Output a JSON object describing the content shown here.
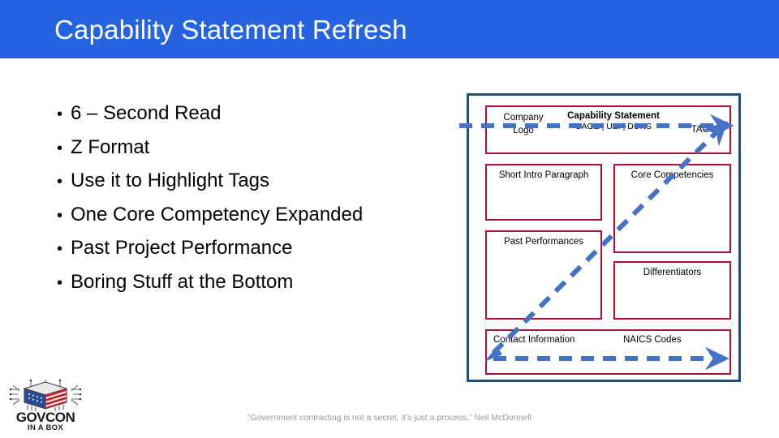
{
  "header": {
    "title": "Capability Statement Refresh",
    "band_color": "#2563E0",
    "title_color": "#FFFFFF"
  },
  "bullets": {
    "items": [
      {
        "marker": "•",
        "label": "6 – Second Read"
      },
      {
        "marker": "•",
        "label": "Z Format"
      },
      {
        "marker": "•",
        "label": "Use it to Highlight Tags"
      },
      {
        "marker": "•",
        "label": "One Core Competency Expanded"
      },
      {
        "marker": "•",
        "label": "Past Project Performance"
      },
      {
        "marker": "•",
        "label": "Boring Stuff at the Bottom"
      }
    ]
  },
  "diagram": {
    "outer_border_color": "#1F4E79",
    "box_border_color": "#B01030",
    "arrow_color": "#4472C4",
    "header_box": {
      "logo_line1": "Company",
      "logo_line2": "Logo",
      "title": "Capability Statement",
      "identifiers": "CAGE | UEI | DUNS",
      "tags": "TAGS"
    },
    "boxes": [
      {
        "id": "intro",
        "label": "Short Intro Paragraph"
      },
      {
        "id": "core",
        "label": "Core Competencies"
      },
      {
        "id": "past",
        "label": "Past Performances"
      },
      {
        "id": "diff",
        "label": "Differentiators"
      }
    ],
    "contact_box": {
      "contact": "Contact Information",
      "naics": "NAICS Codes"
    },
    "arrows": [
      {
        "name": "top-arrow",
        "direction": "left-to-right",
        "style": "dashed"
      },
      {
        "name": "diagonal-arrow",
        "direction": "bottom-left-to-top-right",
        "style": "dashed"
      },
      {
        "name": "bottom-arrow",
        "direction": "left-to-right",
        "style": "dashed"
      }
    ]
  },
  "footer": {
    "quote": "“Government contracting is not a secret, it’s just a process.” Neil McDonnell"
  },
  "logo": {
    "wordmark": "GOVCON",
    "tagline": "IN A BOX"
  }
}
